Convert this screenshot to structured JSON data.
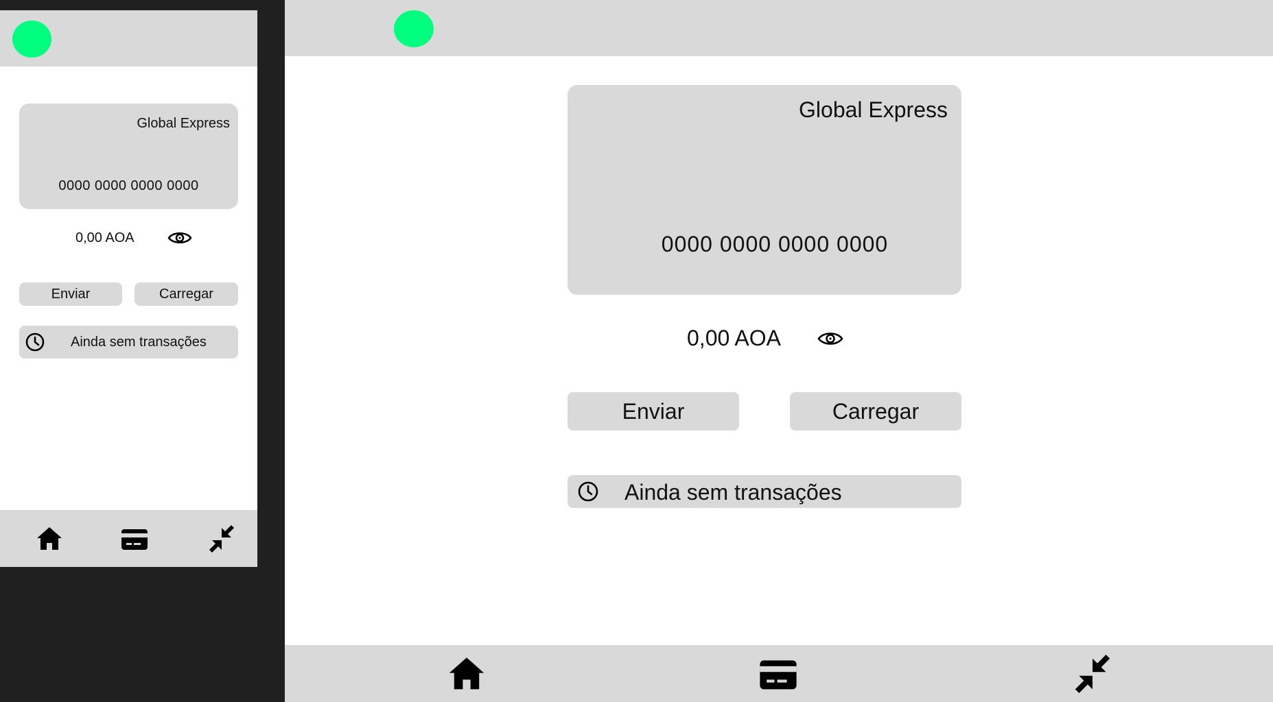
{
  "accent_color": "#00ff7f",
  "mobile": {
    "card": {
      "brand": "Global Express",
      "number": "0000 0000 0000 0000"
    },
    "balance": "0,00 AOA",
    "send_label": "Enviar",
    "load_label": "Carregar",
    "transactions_label": "Ainda sem transações",
    "nav": [
      "home-icon",
      "card-icon",
      "minimize-icon"
    ]
  },
  "desktop": {
    "card": {
      "brand": "Global Express",
      "number": "0000 0000 0000 0000"
    },
    "balance": "0,00 AOA",
    "send_label": "Enviar",
    "load_label": "Carregar",
    "transactions_label": "Ainda sem transações",
    "nav": [
      "home-icon",
      "card-icon",
      "minimize-icon"
    ]
  }
}
